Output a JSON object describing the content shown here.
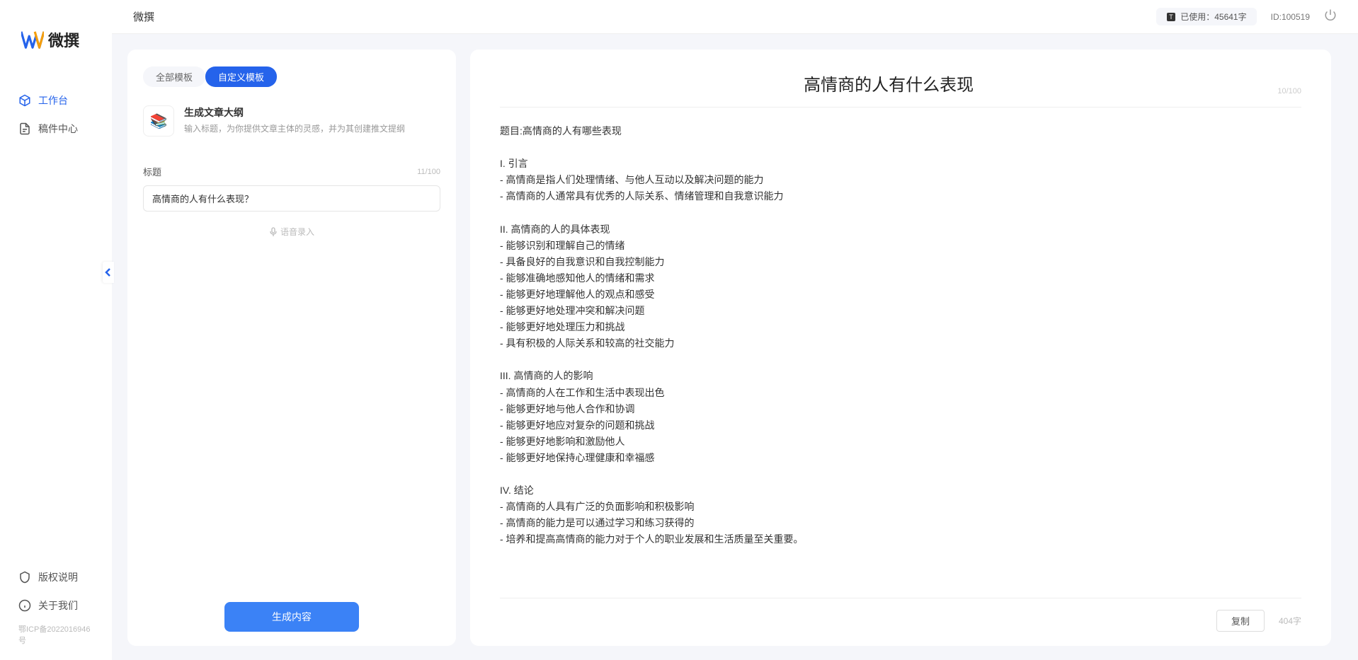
{
  "brand": {
    "name": "微撰"
  },
  "header": {
    "page_title": "微撰",
    "usage_label": "已使用：45641字",
    "user_id": "ID:100519"
  },
  "sidebar": {
    "items": [
      {
        "label": "工作台",
        "active": true
      },
      {
        "label": "稿件中心",
        "active": false
      }
    ],
    "bottom_items": [
      {
        "label": "版权说明"
      },
      {
        "label": "关于我们"
      }
    ],
    "icp": "鄂ICP备2022016946号"
  },
  "left_panel": {
    "tabs": [
      {
        "label": "全部模板",
        "active": false
      },
      {
        "label": "自定义模板",
        "active": true
      }
    ],
    "function": {
      "title": "生成文章大纲",
      "desc": "输入标题，为你提供文章主体的灵感，并为其创建推文提纲"
    },
    "field": {
      "label": "标题",
      "char_count": "11/100",
      "value": "高情商的人有什么表现？"
    },
    "voice": "语音录入",
    "generate": "生成内容"
  },
  "output": {
    "title": "高情商的人有什么表现",
    "header_count": "10/100",
    "body": "题目:高情商的人有哪些表现\n\nI. 引言\n- 高情商是指人们处理情绪、与他人互动以及解决问题的能力\n- 高情商的人通常具有优秀的人际关系、情绪管理和自我意识能力\n\nII. 高情商的人的具体表现\n- 能够识别和理解自己的情绪\n- 具备良好的自我意识和自我控制能力\n- 能够准确地感知他人的情绪和需求\n- 能够更好地理解他人的观点和感受\n- 能够更好地处理冲突和解决问题\n- 能够更好地处理压力和挑战\n- 具有积极的人际关系和较高的社交能力\n\nIII. 高情商的人的影响\n- 高情商的人在工作和生活中表现出色\n- 能够更好地与他人合作和协调\n- 能够更好地应对复杂的问题和挑战\n- 能够更好地影响和激励他人\n- 能够更好地保持心理健康和幸福感\n\nIV. 结论\n- 高情商的人具有广泛的负面影响和积极影响\n- 高情商的能力是可以通过学习和练习获得的\n- 培养和提高高情商的能力对于个人的职业发展和生活质量至关重要。",
    "copy": "复制",
    "word_count": "404字"
  }
}
